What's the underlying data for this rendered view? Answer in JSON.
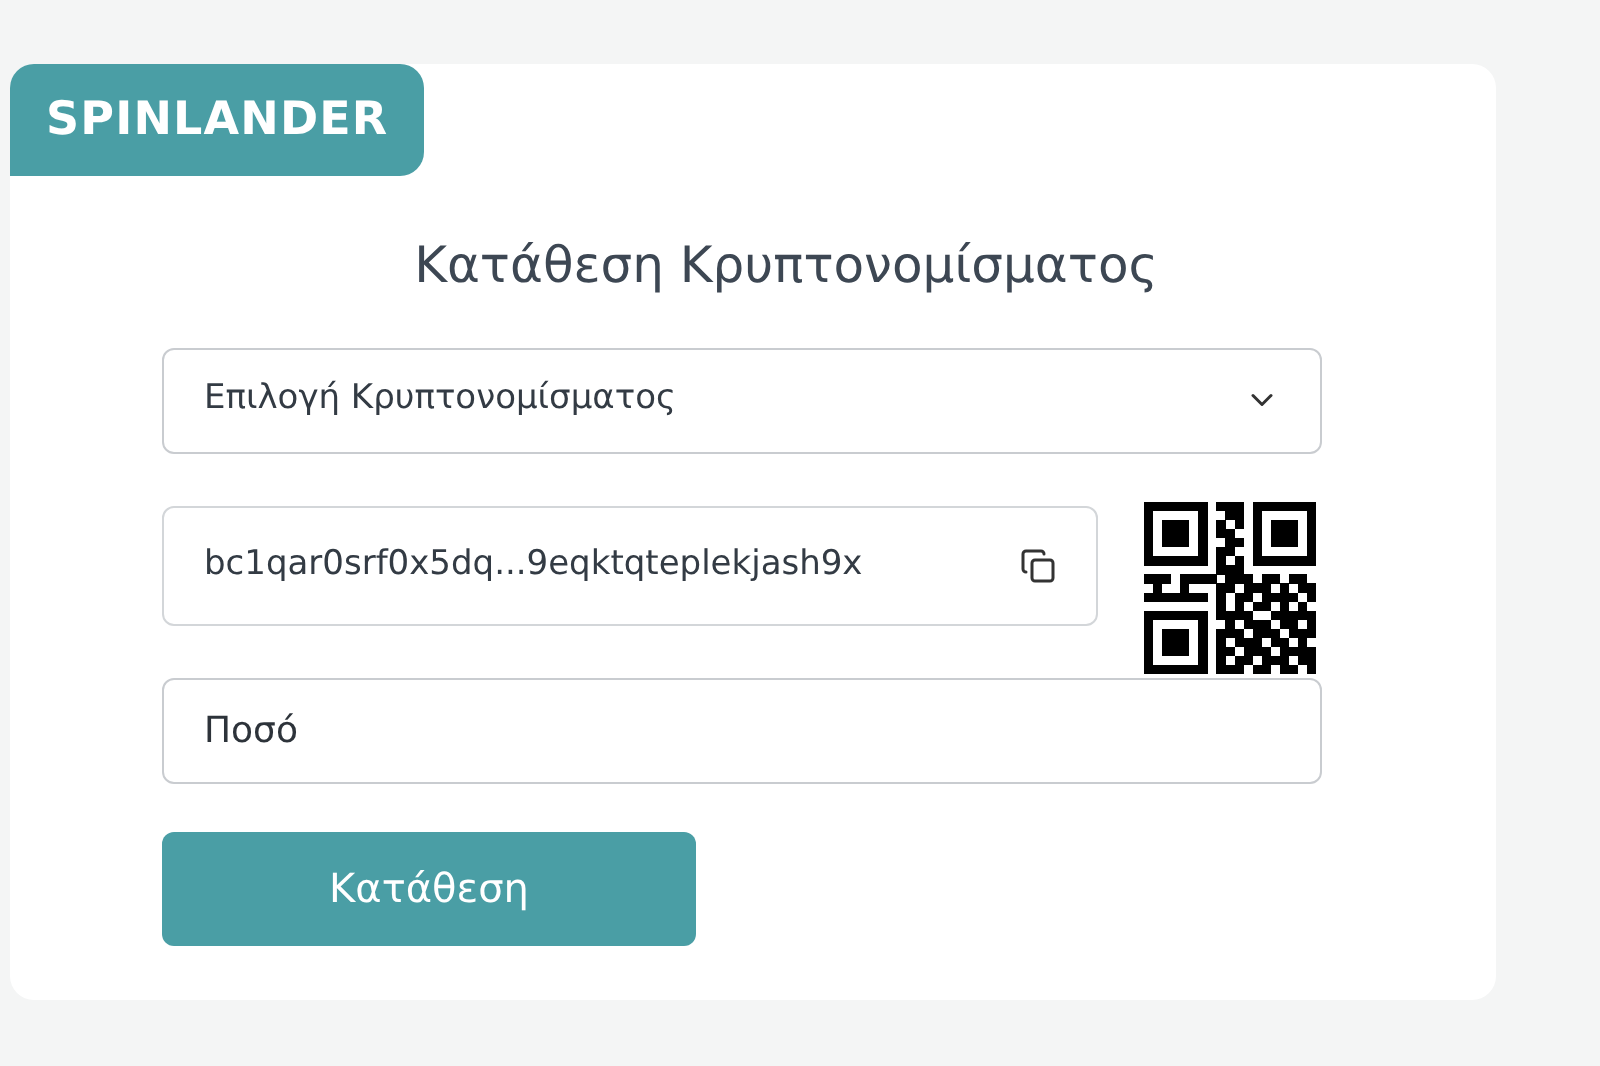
{
  "brand": "SPINLANDER",
  "title": "Κατάθεση Κρυπτονομίσματος",
  "currency_select": {
    "value": "Επιλογή Κρυπτονομίσματος"
  },
  "address_field": {
    "value": "bc1qar0srf0x5dq...9eqktqteplekjash9x"
  },
  "amount_field": {
    "placeholder": "Ποσό"
  },
  "submit_button": "Κατάθεση"
}
